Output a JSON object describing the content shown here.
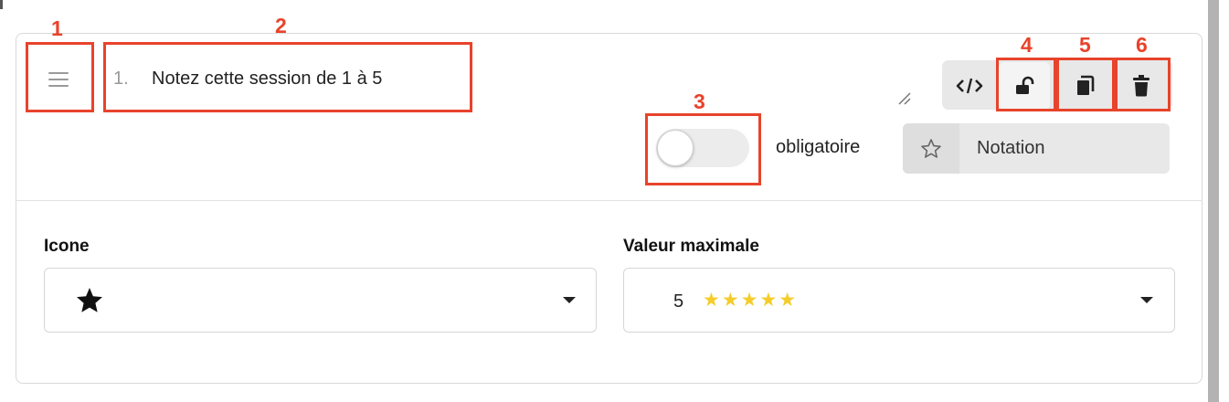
{
  "question": {
    "number": "1.",
    "title": "Notez cette session de 1 à 5"
  },
  "toolbar": {
    "code_icon": "code-icon",
    "lock_icon": "unlock-icon",
    "duplicate_icon": "copy-icon",
    "delete_icon": "trash-icon"
  },
  "required": {
    "label": "obligatoire",
    "enabled": false
  },
  "question_type": {
    "icon": "star-outline-icon",
    "label": "Notation"
  },
  "icon_field": {
    "label": "Icone",
    "selected": "★"
  },
  "max_value_field": {
    "label": "Valeur maximale",
    "selected_value": "5",
    "stars": "★★★★★"
  },
  "annotations": [
    "1",
    "2",
    "3",
    "4",
    "5",
    "6"
  ],
  "colors": {
    "annotation": "#e8432b",
    "star_rating": "#f5cc2a",
    "toggle_off": "#ececec"
  }
}
